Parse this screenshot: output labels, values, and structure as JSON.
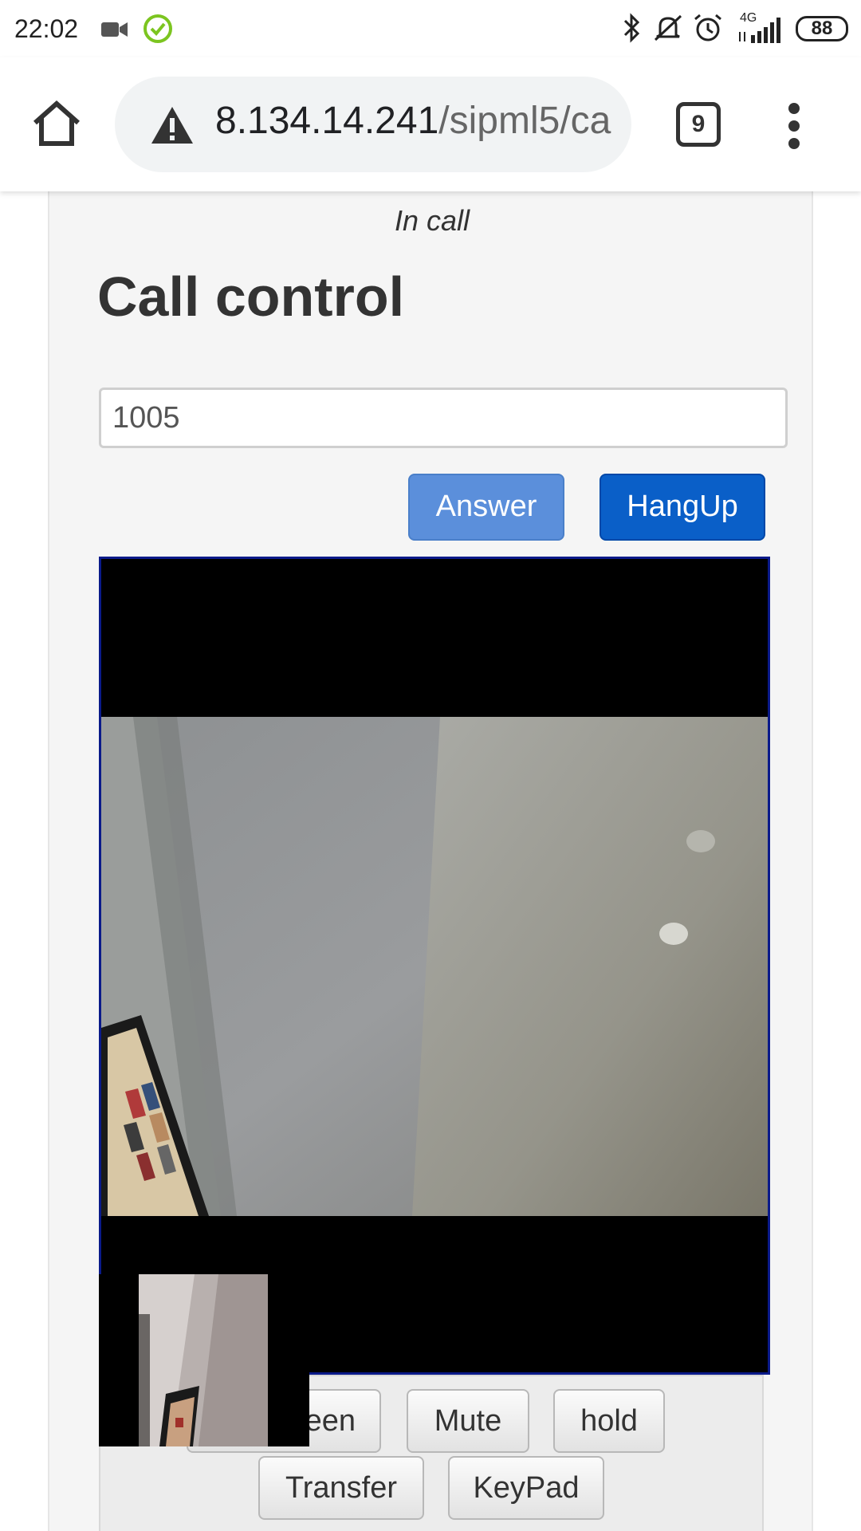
{
  "status_bar": {
    "time": "22:02",
    "battery": "88",
    "network": "4G",
    "icons": [
      "video-camera-icon",
      "check-circle-icon",
      "bluetooth-icon",
      "bell-off-icon",
      "alarm-icon",
      "signal-icon",
      "battery-icon"
    ]
  },
  "browser": {
    "url_host": "8.134.14.241",
    "url_path": "/sipml5/ca",
    "tab_count": "9",
    "icons": [
      "home-icon",
      "warning-icon",
      "more-vert-icon"
    ]
  },
  "call": {
    "status": "In call",
    "title": "Call control",
    "number_value": "1005",
    "answer_label": "Answer",
    "hangup_label": "HangUp",
    "fullscreen_label": "een",
    "mute_label": "Mute",
    "hold_label": "hold",
    "transfer_label": "Transfer",
    "keypad_label": "KeyPad"
  },
  "colors": {
    "answer_button": "#5b8fdb",
    "hangup_button": "#0a5fc8",
    "video_border": "#0a1a8a",
    "check_green": "#7cc520"
  }
}
